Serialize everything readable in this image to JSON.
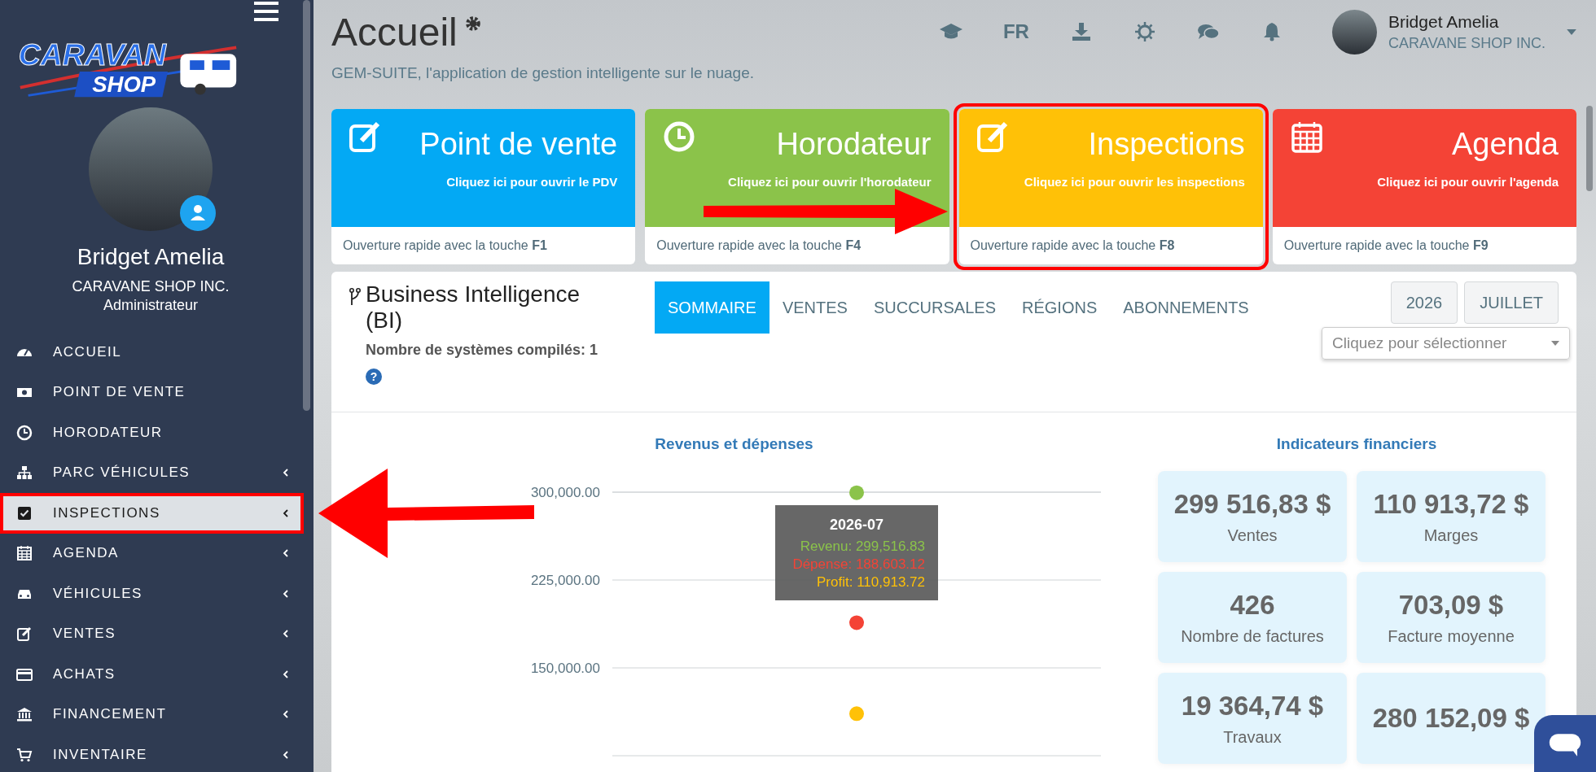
{
  "sidebar": {
    "logo": {
      "line_1": "CARAVAN",
      "line_2": "SHOP"
    },
    "user": {
      "name": "Bridget Amelia",
      "company": "CARAVANE SHOP INC.",
      "role": "Administrateur"
    },
    "items": [
      {
        "label": "ACCUEIL",
        "selected": false,
        "has_submenu": false,
        "annotated": false
      },
      {
        "label": "POINT DE VENTE",
        "selected": false,
        "has_submenu": false,
        "annotated": false
      },
      {
        "label": "HORODATEUR",
        "selected": false,
        "has_submenu": false,
        "annotated": false
      },
      {
        "label": "PARC VÉHICULES",
        "selected": false,
        "has_submenu": true,
        "annotated": false
      },
      {
        "label": "INSPECTIONS",
        "selected": true,
        "has_submenu": true,
        "annotated": true
      },
      {
        "label": "AGENDA",
        "selected": false,
        "has_submenu": true,
        "annotated": false
      },
      {
        "label": "VÉHICULES",
        "selected": false,
        "has_submenu": true,
        "annotated": false
      },
      {
        "label": "VENTES",
        "selected": false,
        "has_submenu": true,
        "annotated": false
      },
      {
        "label": "ACHATS",
        "selected": false,
        "has_submenu": true,
        "annotated": false
      },
      {
        "label": "FINANCEMENT",
        "selected": false,
        "has_submenu": true,
        "annotated": false
      },
      {
        "label": "INVENTAIRE",
        "selected": false,
        "has_submenu": true,
        "annotated": false
      }
    ]
  },
  "header": {
    "title": "Accueil",
    "subtitle": "GEM-SUITE, l'application de gestion intelligente sur le nuage.",
    "language": "FR",
    "user": {
      "name": "Bridget Amelia",
      "company": "CARAVANE SHOP INC."
    }
  },
  "tiles": [
    {
      "title": "Point de vente",
      "subtitle": "Cliquez ici pour ouvrir le PDV",
      "shortcut_text": "Ouverture rapide avec la touche",
      "key": "F1",
      "color": "#03a9f4",
      "annotated": false
    },
    {
      "title": "Horodateur",
      "subtitle": "Cliquez ici pour ouvrir l'horodateur",
      "shortcut_text": "Ouverture rapide avec la touche",
      "key": "F4",
      "color": "#8bc34a",
      "annotated": false
    },
    {
      "title": "Inspections",
      "subtitle": "Cliquez ici pour ouvrir les inspections",
      "shortcut_text": "Ouverture rapide avec la touche",
      "key": "F8",
      "color": "#ffc107",
      "annotated": true
    },
    {
      "title": "Agenda",
      "subtitle": "Cliquez ici pour ouvrir l'agenda",
      "shortcut_text": "Ouverture rapide avec la touche",
      "key": "F9",
      "color": "#f44336",
      "annotated": false
    }
  ],
  "bi": {
    "title": "Business Intelligence (BI)",
    "tabs": [
      {
        "label": "SOMMAIRE",
        "selected": true
      },
      {
        "label": "VENTES",
        "selected": false
      },
      {
        "label": "SUCCURSALES",
        "selected": false
      },
      {
        "label": "RÉGIONS",
        "selected": false
      },
      {
        "label": "ABONNEMENTS",
        "selected": false
      }
    ],
    "year": "2026",
    "month": "JUILLET",
    "select_placeholder": "Cliquez pour sélectionner",
    "compiled_systems": "Nombre de systèmes compilés: 1",
    "help_icon": "?",
    "chart_data": {
      "type": "scatter",
      "title": "Revenus et dépenses",
      "categories": [
        "2026-07"
      ],
      "grid": true,
      "ylim": [
        75000,
        300000
      ],
      "yticks": [
        {
          "value": 150000,
          "label": "150,000.00"
        },
        {
          "value": 225000,
          "label": "225,000.00"
        },
        {
          "value": 300000,
          "label": "300,000.00"
        }
      ],
      "series": [
        {
          "name": "Revenu",
          "color": "#8bc34a",
          "values": [
            299517
          ]
        },
        {
          "name": "Dépense",
          "color": "#f44336",
          "values": [
            188603
          ]
        },
        {
          "name": "Profit",
          "color": "#ffc107",
          "values": [
            110914
          ]
        }
      ]
    },
    "tooltip": {
      "separator": ":",
      "values": [
        "299,516.83",
        "188,603.12",
        "110,913.72"
      ]
    },
    "indicators": {
      "title": "Indicateurs financiers",
      "cards": [
        {
          "value": "299 516,83 $",
          "label": "Ventes"
        },
        {
          "value": "110 913,72 $",
          "label": "Marges"
        },
        {
          "value": "426",
          "label": "Nombre de factures"
        },
        {
          "value": "703,09 $",
          "label": "Facture moyenne"
        },
        {
          "value": "19 364,74 $",
          "label": "Travaux"
        },
        {
          "value": "280 152,09 $"
        }
      ]
    }
  }
}
